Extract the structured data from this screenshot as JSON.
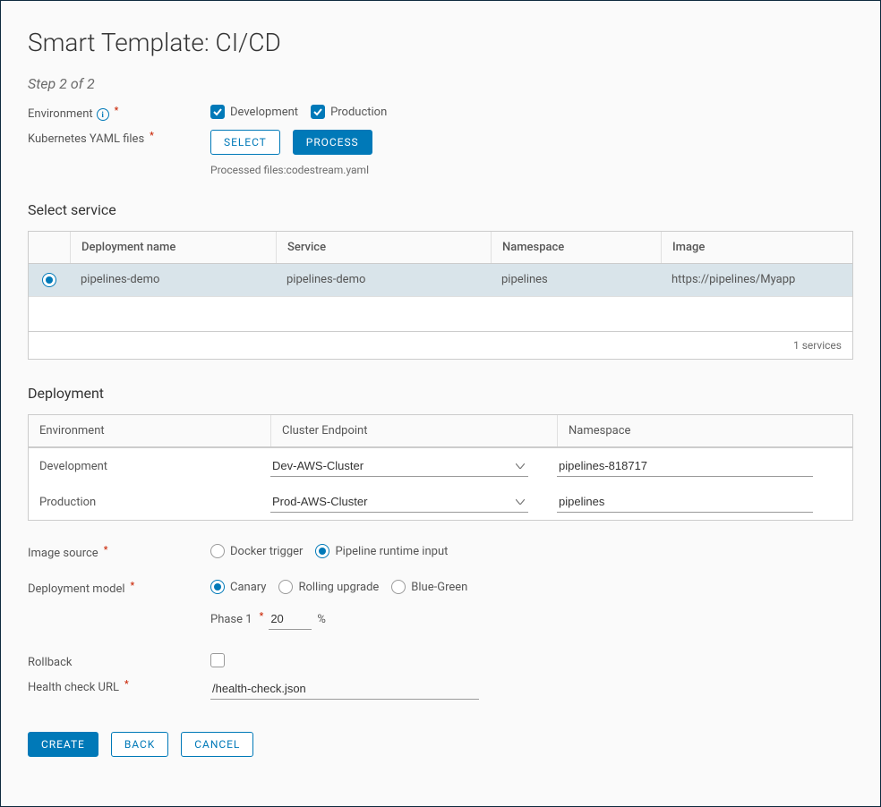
{
  "title": "Smart Template: CI/CD",
  "step": "Step 2 of 2",
  "labels": {
    "environment": "Environment",
    "yaml": "Kubernetes YAML files",
    "image_source": "Image source",
    "deployment_model": "Deployment model",
    "rollback": "Rollback",
    "health_url": "Health check URL",
    "phase": "Phase 1",
    "percent": "%"
  },
  "env": {
    "dev_label": "Development",
    "dev_checked": true,
    "prod_label": "Production",
    "prod_checked": true
  },
  "buttons": {
    "select": "SELECT",
    "process": "PROCESS",
    "create": "CREATE",
    "back": "BACK",
    "cancel": "CANCEL"
  },
  "processed": "Processed files:codestream.yaml",
  "section_select_service": "Select service",
  "service_table": {
    "headers": {
      "deployment": "Deployment name",
      "service": "Service",
      "namespace": "Namespace",
      "image": "Image"
    },
    "rows": [
      {
        "deployment": "pipelines-demo",
        "service": "pipelines-demo",
        "namespace": "pipelines",
        "image": "https://pipelines/Myapp",
        "selected": true
      }
    ],
    "footer": "1 services"
  },
  "section_deployment": "Deployment",
  "deployment_table": {
    "headers": {
      "env": "Environment",
      "cluster": "Cluster Endpoint",
      "namespace": "Namespace"
    },
    "rows": [
      {
        "env": "Development",
        "cluster": "Dev-AWS-Cluster",
        "namespace": "pipelines-818717"
      },
      {
        "env": "Production",
        "cluster": "Prod-AWS-Cluster",
        "namespace": "pipelines"
      }
    ]
  },
  "image_source": {
    "docker": "Docker trigger",
    "runtime": "Pipeline runtime input",
    "selected": "runtime"
  },
  "deployment_model": {
    "canary": "Canary",
    "rolling": "Rolling upgrade",
    "blue_green": "Blue-Green",
    "selected": "canary",
    "phase_value": "20"
  },
  "rollback_checked": false,
  "health_url_value": "/health-check.json"
}
